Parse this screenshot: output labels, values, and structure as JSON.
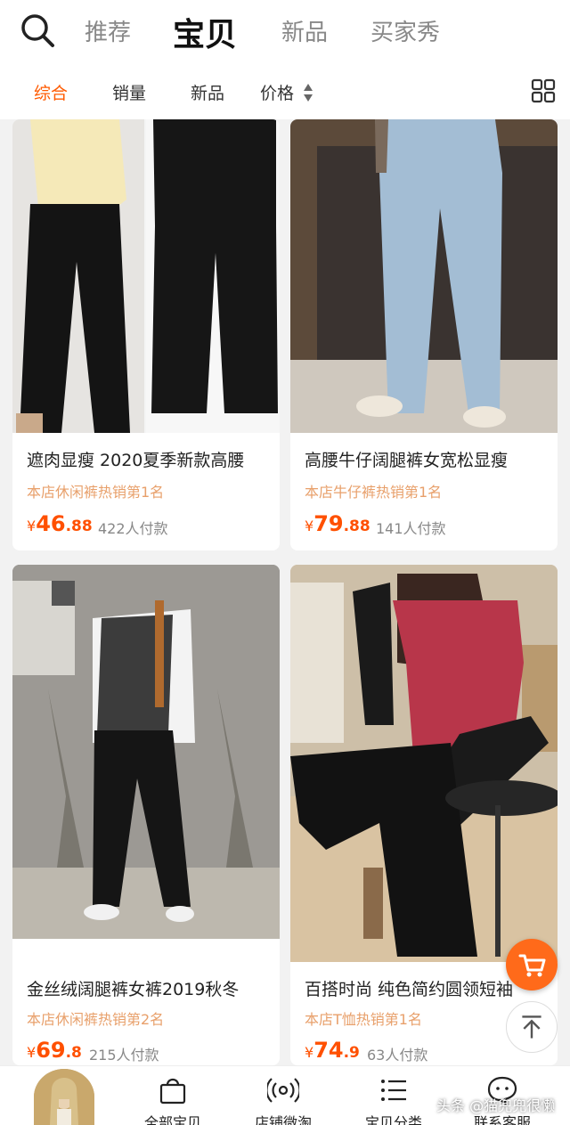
{
  "top_tabs": [
    {
      "label": "推荐"
    },
    {
      "label": "宝贝",
      "active": true
    },
    {
      "label": "新品"
    },
    {
      "label": "买家秀"
    }
  ],
  "filters": [
    {
      "label": "综合",
      "active": true
    },
    {
      "label": "销量"
    },
    {
      "label": "新品"
    },
    {
      "label": "价格"
    }
  ],
  "accent_color": "#ff5a00",
  "products": [
    {
      "title": "遮肉显瘦 2020夏季新款高腰",
      "rank": "本店休闲裤热销第1名",
      "currency": "¥",
      "price_int": "46",
      "price_dec": ".88",
      "sold": "422人付款"
    },
    {
      "title": "高腰牛仔阔腿裤女宽松显瘦",
      "rank": "本店牛仔裤热销第1名",
      "currency": "¥",
      "price_int": "79",
      "price_dec": ".88",
      "sold": "141人付款"
    },
    {
      "title": "金丝绒阔腿裤女裤2019秋冬",
      "rank": "本店休闲裤热销第2名",
      "currency": "¥",
      "price_int": "69",
      "price_dec": ".8",
      "sold": "215人付款"
    },
    {
      "title": "百搭时尚 纯色简约圆领短袖",
      "rank": "本店T恤热销第1名",
      "currency": "¥",
      "price_int": "74",
      "price_dec": ".9",
      "sold": "63人付款"
    }
  ],
  "bottom_nav": [
    {
      "label": "全部宝贝",
      "icon": "bag-icon"
    },
    {
      "label": "店铺微淘",
      "icon": "broadcast-icon"
    },
    {
      "label": "宝贝分类",
      "icon": "list-icon"
    },
    {
      "label": "联系客服",
      "icon": "chat-icon"
    }
  ],
  "watermark": "头条 @猫兜兜很懒"
}
